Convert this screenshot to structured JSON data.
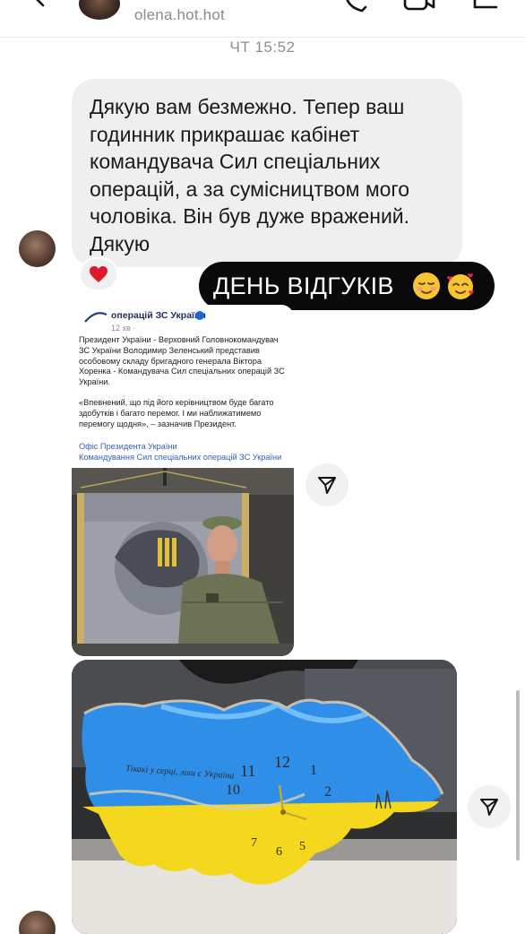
{
  "header": {
    "username": "olena.hot.hot"
  },
  "thread": {
    "timestamp": "ЧТ 15:52",
    "message": {
      "lines": [
        "Дякую вам безмежно. Тепер ваш",
        "годинник прикрашає кабінет",
        "командувача Сил спеціальних",
        "операцій, а за сумісництвом мого",
        "чоловіка. Він був дуже вражений.",
        "Дякую"
      ],
      "reaction": "❤"
    },
    "label": {
      "text": "ДЕНЬ ВІДГУКІВ"
    },
    "post": {
      "account": "операцій ЗС України",
      "date": "12 хв ·",
      "body": "Президент України - Верховний Головнокомандувач ЗС України Володимир Зеленський представив особовому складу бригадного генерала Віктора Хоренка - Командувача Сил спеціальних операцій ЗС України.",
      "quote": "«Впевнений, що під його керівництвом буде багато здобутків і багато перемог. І ми наближатимемо перемогу щодня», – зазначив Президент.",
      "link1": "Офіс Президента України",
      "link2": "Командування Сил спеціальних операцій ЗС України"
    },
    "clock": {
      "inscription": "Тікакі у серці, лиш с Україна",
      "numbers": [
        "11",
        "12",
        "1",
        "2",
        "10",
        "5",
        "6",
        "7"
      ]
    }
  },
  "colors": {
    "bubble": "#efefef",
    "label_bg": "#0a0a0a",
    "heart": "#e0182d",
    "resin_blue": "#2f8fe8",
    "resin_yellow": "#f3d81e"
  },
  "icons": {
    "back": "back-arrow-icon",
    "call": "phone-icon",
    "video": "video-camera-icon",
    "info": "info-icon",
    "share": "paper-plane-icon",
    "heart": "heart-icon"
  }
}
